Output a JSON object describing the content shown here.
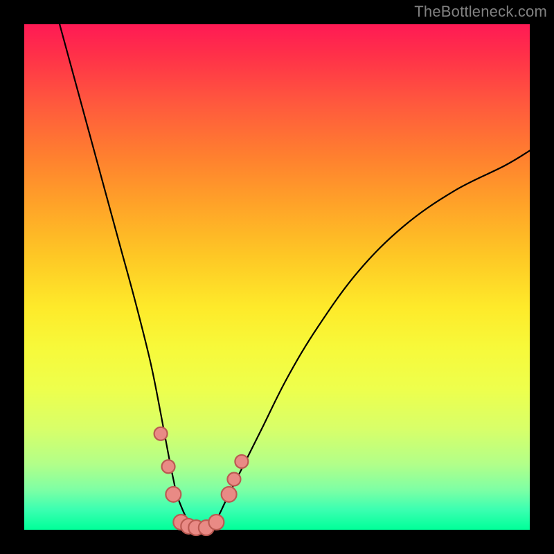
{
  "watermark": "TheBottleneck.com",
  "chart_data": {
    "type": "line",
    "title": "",
    "xlabel": "",
    "ylabel": "",
    "xlim": [
      0,
      100
    ],
    "ylim": [
      0,
      100
    ],
    "grid": false,
    "legend": false,
    "background_gradient": {
      "orientation": "vertical",
      "stops": [
        {
          "pos": 0,
          "color": "#ff1a55"
        },
        {
          "pos": 50,
          "color": "#feea2a"
        },
        {
          "pos": 100,
          "color": "#00ff99"
        }
      ]
    },
    "series": [
      {
        "name": "left-branch",
        "x": [
          7,
          10,
          13,
          16,
          19,
          22,
          25,
          27,
          28.5,
          29.5,
          30.5,
          33,
          36
        ],
        "y": [
          100,
          89,
          78,
          67,
          56,
          45,
          33,
          23,
          15,
          10,
          6,
          1,
          0
        ]
      },
      {
        "name": "right-branch",
        "x": [
          36,
          38,
          40,
          43,
          47,
          52,
          58,
          66,
          75,
          85,
          95,
          100
        ],
        "y": [
          0,
          2,
          6,
          12,
          20,
          30,
          40,
          51,
          60,
          67,
          72,
          75
        ]
      }
    ],
    "markers": [
      {
        "x": 27.0,
        "y": 19.0,
        "r": 1.3
      },
      {
        "x": 28.5,
        "y": 12.5,
        "r": 1.3
      },
      {
        "x": 29.5,
        "y": 7.0,
        "r": 1.5
      },
      {
        "x": 31.0,
        "y": 1.5,
        "r": 1.5
      },
      {
        "x": 32.5,
        "y": 0.7,
        "r": 1.5
      },
      {
        "x": 34.0,
        "y": 0.4,
        "r": 1.5
      },
      {
        "x": 36.0,
        "y": 0.4,
        "r": 1.5
      },
      {
        "x": 38.0,
        "y": 1.5,
        "r": 1.5
      },
      {
        "x": 40.5,
        "y": 7.0,
        "r": 1.5
      },
      {
        "x": 41.5,
        "y": 10.0,
        "r": 1.3
      },
      {
        "x": 43.0,
        "y": 13.5,
        "r": 1.3
      }
    ]
  }
}
